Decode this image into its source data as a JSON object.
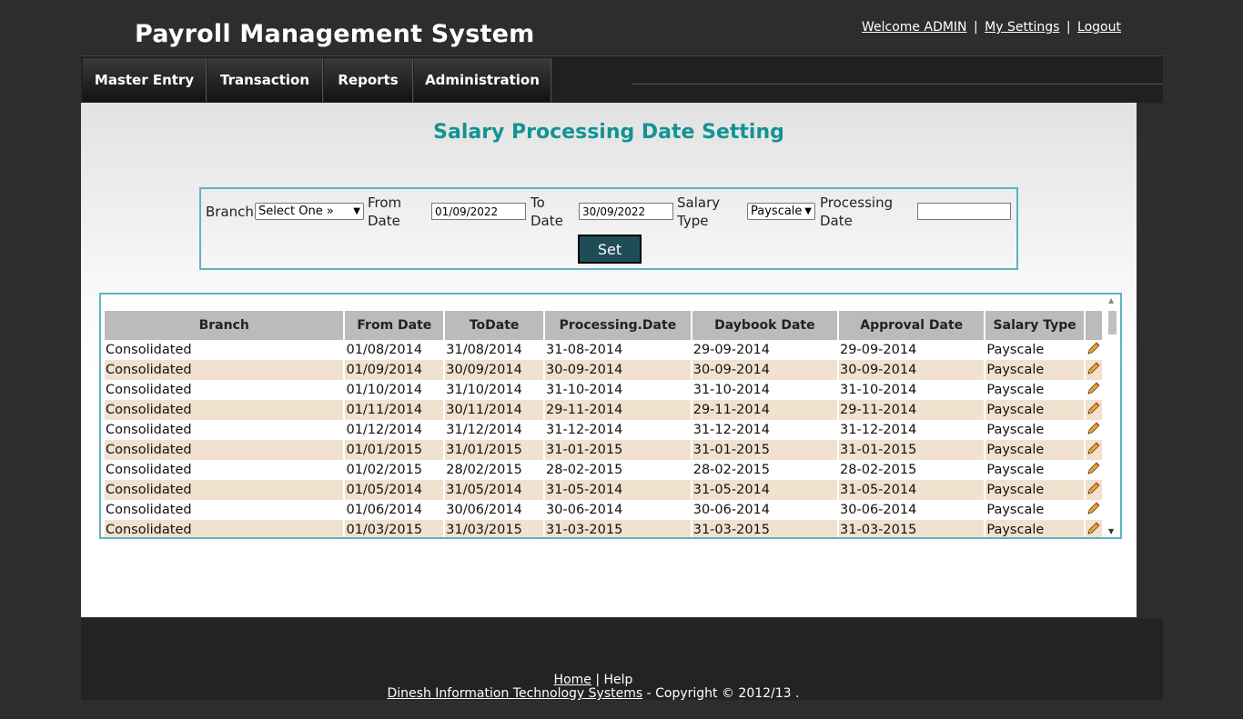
{
  "header": {
    "app_title": "Payroll Management System",
    "welcome": "Welcome ADMIN",
    "my_settings": "My Settings",
    "logout": "Logout",
    "separator": "|"
  },
  "nav": {
    "items": [
      {
        "label": "Master Entry"
      },
      {
        "label": "Transaction"
      },
      {
        "label": "Reports"
      },
      {
        "label": "Administration"
      }
    ]
  },
  "page": {
    "title": "Salary Processing Date Setting"
  },
  "filter": {
    "branch_label": "Branch",
    "branch_value": "Select One »",
    "from_label_1": "From",
    "from_label_2": "Date",
    "from_value": "01/09/2022",
    "to_label_1": "To",
    "to_label_2": "Date",
    "to_value": "30/09/2022",
    "salary_label_1": "Salary",
    "salary_label_2": "Type",
    "salary_value": "Payscale",
    "processing_label_1": "Processing",
    "processing_label_2": "Date",
    "processing_value": "",
    "set_label": "Set"
  },
  "grid": {
    "columns": [
      "Branch",
      "From Date",
      "ToDate",
      "Processing.Date",
      "Daybook Date",
      "Approval Date",
      "Salary Type"
    ],
    "rows": [
      [
        "Consolidated",
        "01/08/2014",
        "31/08/2014",
        "31-08-2014",
        "29-09-2014",
        "29-09-2014",
        "Payscale"
      ],
      [
        "Consolidated",
        "01/09/2014",
        "30/09/2014",
        "30-09-2014",
        "30-09-2014",
        "30-09-2014",
        "Payscale"
      ],
      [
        "Consolidated",
        "01/10/2014",
        "31/10/2014",
        "31-10-2014",
        "31-10-2014",
        "31-10-2014",
        "Payscale"
      ],
      [
        "Consolidated",
        "01/11/2014",
        "30/11/2014",
        "29-11-2014",
        "29-11-2014",
        "29-11-2014",
        "Payscale"
      ],
      [
        "Consolidated",
        "01/12/2014",
        "31/12/2014",
        "31-12-2014",
        "31-12-2014",
        "31-12-2014",
        "Payscale"
      ],
      [
        "Consolidated",
        "01/01/2015",
        "31/01/2015",
        "31-01-2015",
        "31-01-2015",
        "31-01-2015",
        "Payscale"
      ],
      [
        "Consolidated",
        "01/02/2015",
        "28/02/2015",
        "28-02-2015",
        "28-02-2015",
        "28-02-2015",
        "Payscale"
      ],
      [
        "Consolidated",
        "01/05/2014",
        "31/05/2014",
        "31-05-2014",
        "31-05-2014",
        "31-05-2014",
        "Payscale"
      ],
      [
        "Consolidated",
        "01/06/2014",
        "30/06/2014",
        "30-06-2014",
        "30-06-2014",
        "30-06-2014",
        "Payscale"
      ],
      [
        "Consolidated",
        "01/03/2015",
        "31/03/2015",
        "31-03-2015",
        "31-03-2015",
        "31-03-2015",
        "Payscale"
      ]
    ]
  },
  "footer": {
    "home": "Home",
    "separator": "|",
    "help": "Help",
    "company": "Dinesh Information Technology Systems",
    "copyright": "- Copyright © 2012/13 ."
  },
  "icons": {
    "edit": "pencil-icon"
  }
}
